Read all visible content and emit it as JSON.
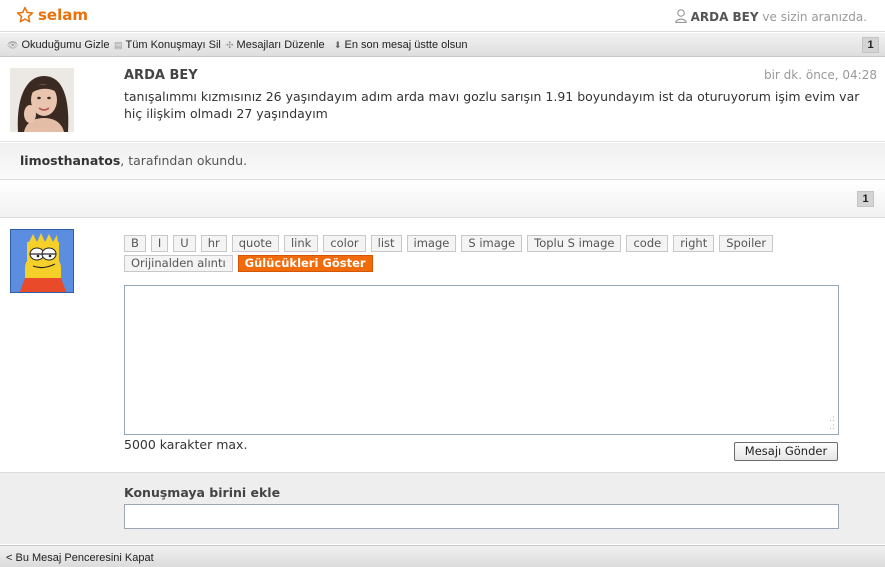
{
  "header": {
    "title": "selam",
    "presence_user": "ARDA BEY",
    "presence_text": " ve sizin aranızda."
  },
  "toolbar": {
    "items": [
      {
        "icon": "eye-icon",
        "label": "Okuduğumu Gizle"
      },
      {
        "icon": "trash-icon",
        "label": "Tüm Konuşmayı Sil"
      },
      {
        "icon": "move-icon",
        "label": "Mesajları Düzenle"
      },
      {
        "icon": "arrow-down-icon",
        "label": "En son mesaj üstte olsun"
      }
    ],
    "page": "1"
  },
  "message": {
    "author": "ARDA BEY",
    "time": "bir dk. önce, 04:28",
    "text": "tanışalımmı kızmısınız 26 yaşındayım adım arda mavı gozlu sarışın 1.91 boyundayım ist da oturuyorum işim evim var hiç ilişkim olmadı 27 yaşındayım"
  },
  "read_by": {
    "user": "limosthanatos",
    "text": ", tarafından okundu."
  },
  "pager": {
    "page": "1"
  },
  "compose": {
    "format_buttons_row1": [
      "B",
      "I",
      "U",
      "hr",
      "quote",
      "link",
      "color",
      "list",
      "image",
      "S image",
      "Toplu S image",
      "code",
      "right",
      "Spoiler"
    ],
    "format_buttons_row2": [
      "Orijinalden alıntı"
    ],
    "smileys_button": "Gülücükleri Göster",
    "max_chars": "5000 karakter max.",
    "send_button": "Mesajı Gönder"
  },
  "add_person": {
    "label": "Konuşmaya birini ekle",
    "value": ""
  },
  "footer": {
    "close_link": "< Bu Mesaj Penceresini Kapat"
  },
  "colors": {
    "accent": "#e8710a",
    "smiley_button": "#f26b0a"
  }
}
